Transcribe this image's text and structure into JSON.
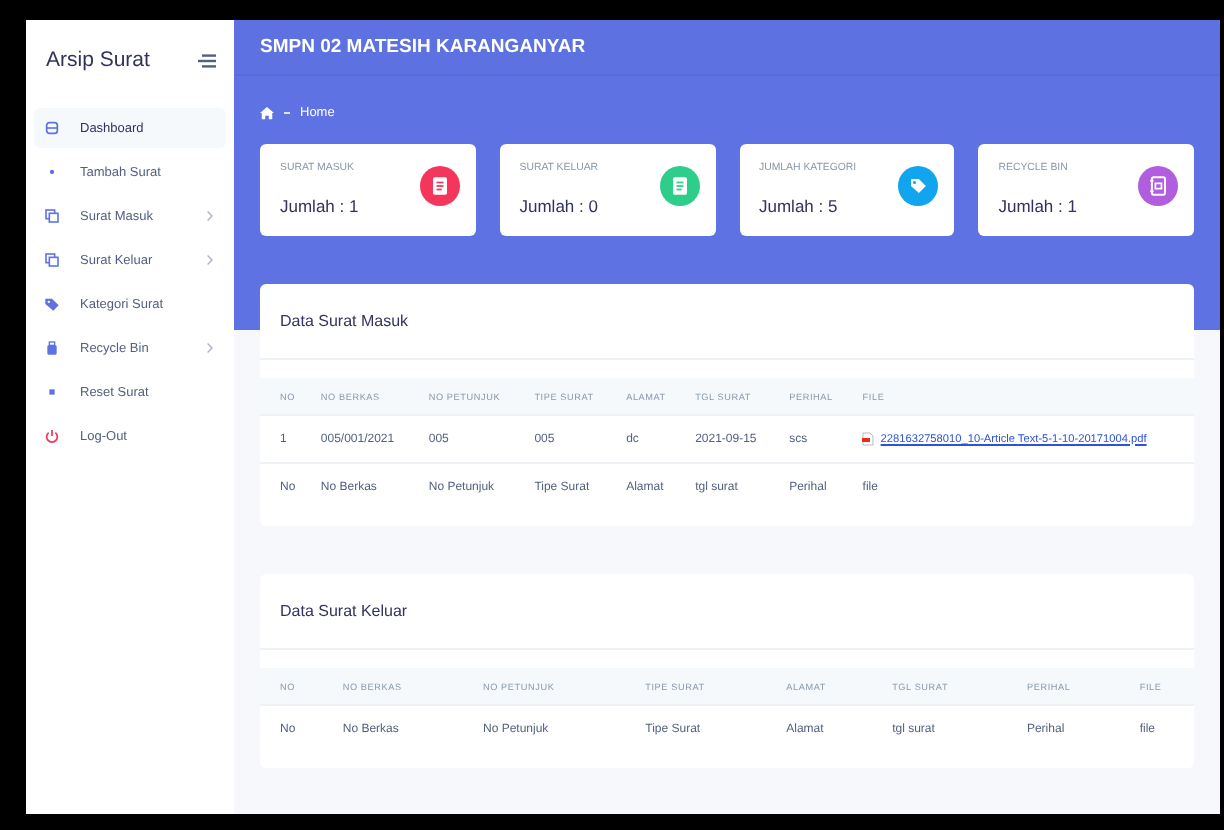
{
  "sidebar": {
    "brand": "Arsip Surat",
    "items": [
      {
        "label": "Dashboard",
        "selected": true,
        "expandable": false
      },
      {
        "label": "Tambah Surat",
        "selected": false,
        "expandable": false
      },
      {
        "label": "Surat Masuk",
        "selected": false,
        "expandable": true
      },
      {
        "label": "Surat Keluar",
        "selected": false,
        "expandable": true
      },
      {
        "label": "Kategori Surat",
        "selected": false,
        "expandable": false
      },
      {
        "label": "Recycle Bin",
        "selected": false,
        "expandable": true
      },
      {
        "label": "Reset Surat",
        "selected": false,
        "expandable": false
      },
      {
        "label": "Log-Out",
        "selected": false,
        "expandable": false
      }
    ]
  },
  "header": {
    "title": "SMPN 02 MATESIH KARANGANYAR"
  },
  "breadcrumb": [
    "Home"
  ],
  "stats": [
    {
      "title": "SURAT MASUK",
      "value": "Jumlah : 1",
      "color": "#f5365c"
    },
    {
      "title": "SURAT KELUAR",
      "value": "Jumlah : 0",
      "color": "#2dce89"
    },
    {
      "title": "JUMLAH KATEGORI",
      "value": "Jumlah : 5",
      "color": "#11a5ef"
    },
    {
      "title": "RECYCLE BIN",
      "value": "Jumlah : 1",
      "color": "#b05de0"
    }
  ],
  "tables": [
    {
      "title": "Data Surat Masuk",
      "columns": [
        "NO",
        "NO BERKAS",
        "NO PETUNJUK",
        "TIPE SURAT",
        "ALAMAT",
        "TGL SURAT",
        "PERIHAL",
        "FILE"
      ],
      "rows": [
        {
          "cells": [
            "1",
            "005/001/2021",
            "005",
            "005",
            "dc",
            "2021-09-15",
            "scs"
          ],
          "file": {
            "kind": "pdf-link",
            "text": "2281632758010_10-Article Text-5-1-10-20171004.pdf"
          }
        },
        {
          "cells": [
            "No",
            "No Berkas",
            "No Petunjuk",
            "Tipe Surat",
            "Alamat",
            "tgl surat",
            "Perihal"
          ],
          "file": {
            "kind": "text",
            "text": "file"
          }
        }
      ]
    },
    {
      "title": "Data Surat Keluar",
      "columns": [
        "NO",
        "NO BERKAS",
        "NO PETUNJUK",
        "TIPE SURAT",
        "ALAMAT",
        "TGL SURAT",
        "PERIHAL",
        "FILE"
      ],
      "rows": [
        {
          "cells": [
            "No",
            "No Berkas",
            "No Petunjuk",
            "Tipe Surat",
            "Alamat",
            "tgl surat",
            "Perihal"
          ],
          "file": {
            "kind": "text",
            "text": "file"
          }
        }
      ]
    }
  ]
}
